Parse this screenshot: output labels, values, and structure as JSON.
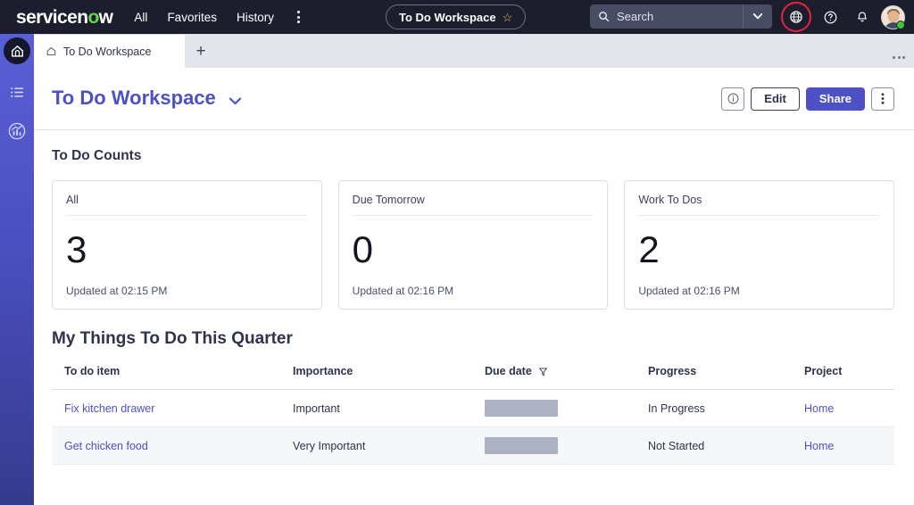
{
  "header": {
    "brand_pre": "servicen",
    "brand_o": "o",
    "brand_post": "w",
    "nav": [
      {
        "label": "All",
        "name": "nav-all"
      },
      {
        "label": "Favorites",
        "name": "nav-favorites"
      },
      {
        "label": "History",
        "name": "nav-history"
      }
    ],
    "more_menu_name": "header-more-menu",
    "workspace_pill": {
      "label": "To Do Workspace",
      "star_glyph": "☆"
    },
    "search": {
      "placeholder": "Search",
      "value": "",
      "icon": "search-icon",
      "caret_icon": "chevron-down-icon"
    },
    "icons": [
      {
        "name": "globe-icon",
        "highlighted": true,
        "highlight_color": "#e8233f"
      },
      {
        "name": "help-icon",
        "highlighted": false
      },
      {
        "name": "bell-icon",
        "highlighted": false
      }
    ],
    "avatar": {
      "name": "user-avatar",
      "status": "online"
    }
  },
  "rail": {
    "items": [
      {
        "name": "rail-home-icon",
        "label": "Home"
      },
      {
        "name": "rail-list-icon",
        "label": "List"
      },
      {
        "name": "rail-analytics-icon",
        "label": "Analytics"
      }
    ]
  },
  "tabstrip": {
    "tabs": [
      {
        "label": "To Do Workspace",
        "icon": "home-icon",
        "active": true
      }
    ],
    "add_label": "+",
    "more_name": "tabstrip-overflow-menu"
  },
  "page": {
    "title": "To Do Workspace",
    "title_caret": "chevron-down-icon",
    "actions": {
      "info_label": "ⓘ",
      "edit_label": "Edit",
      "share_label": "Share",
      "more_label": "⋮"
    }
  },
  "counts_section": {
    "title": "To Do Counts",
    "cards": [
      {
        "title": "All",
        "value": "3",
        "updated": "Updated at 02:15 PM"
      },
      {
        "title": "Due Tomorrow",
        "value": "0",
        "updated": "Updated at 02:16 PM"
      },
      {
        "title": "Work To Dos",
        "value": "2",
        "updated": "Updated at 02:16 PM"
      }
    ]
  },
  "table_section": {
    "title": "My Things To Do This Quarter",
    "columns": [
      {
        "label": "To do item",
        "sorted": false
      },
      {
        "label": "Importance",
        "sorted": false
      },
      {
        "label": "Due date",
        "sorted": true,
        "sort_icon": "filter-funnel-icon"
      },
      {
        "label": "Progress",
        "sorted": false
      },
      {
        "label": "Project",
        "sorted": false
      }
    ],
    "rows": [
      {
        "item": "Fix kitchen drawer",
        "importance": "Important",
        "due_date": "",
        "due_date_masked": true,
        "progress": "In Progress",
        "project": "Home"
      },
      {
        "item": "Get chicken food",
        "importance": "Very Important",
        "due_date": "",
        "due_date_masked": true,
        "progress": "Not Started",
        "project": "Home"
      }
    ]
  },
  "colors": {
    "accent": "#4c51c6",
    "header_bg": "#1c1e2e",
    "rail_top": "#5b5fd6",
    "rail_bottom": "#363a8c",
    "link": "#4c51c6",
    "highlight_ring": "#e8233f",
    "mask": "#acb2c4"
  }
}
